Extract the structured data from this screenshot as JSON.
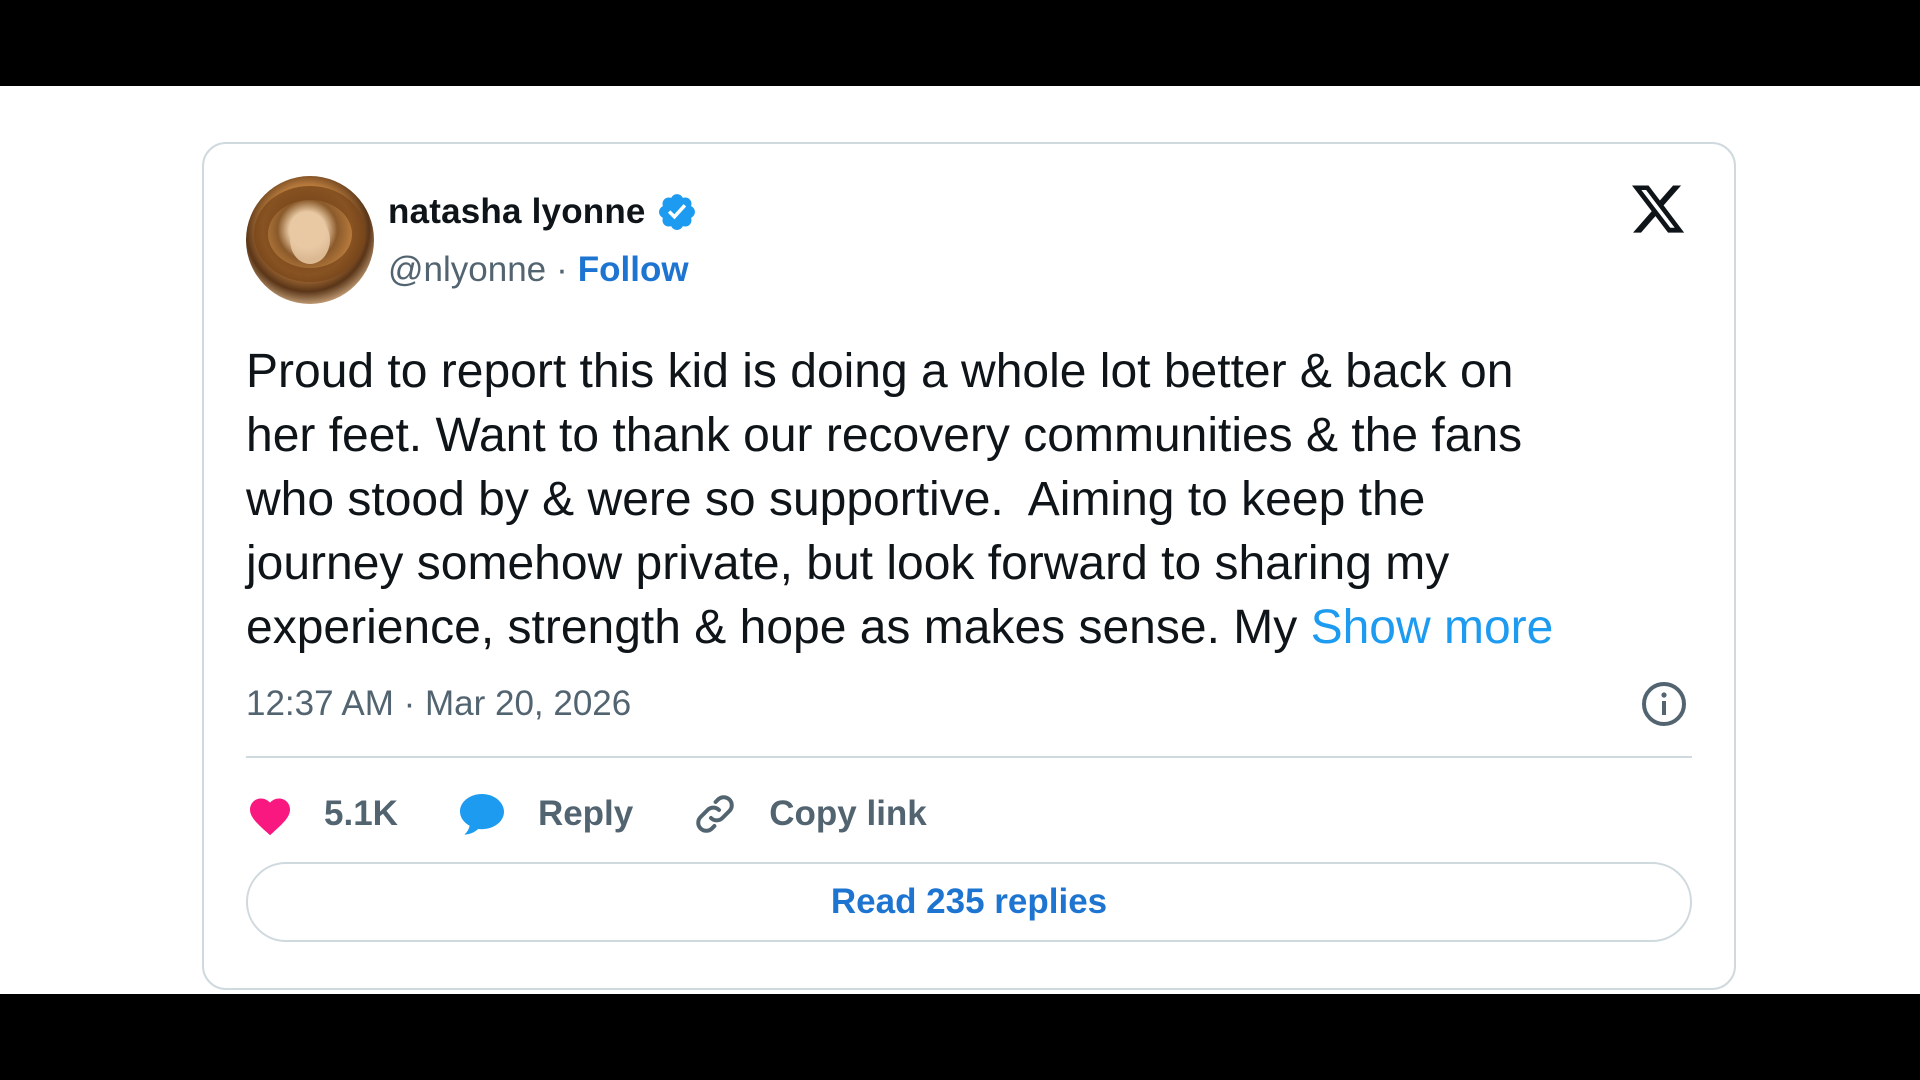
{
  "tweet": {
    "author_name": "natasha lyonne",
    "handle": "@nlyonne",
    "separator": "·",
    "follow_label": "Follow",
    "verified": true,
    "body": "Proud to report this kid is doing a whole lot better & back on\nher feet. Want to thank our recovery communities & the fans\nwho stood by & were so supportive.  Aiming to keep the\njourney somehow private, but look forward to sharing my\nexperience, strength & hope as makes sense. My ",
    "show_more_label": "Show more",
    "timestamp": "12:37 AM · Mar 20, 2026"
  },
  "actions": {
    "likes": "5.1K",
    "reply_label": "Reply",
    "copy_link_label": "Copy link"
  },
  "replies_button_label": "Read 235 replies",
  "icons": {
    "platform": "x-logo-icon",
    "verified": "verified-badge-icon",
    "info": "info-icon",
    "like": "heart-icon",
    "reply": "speech-bubble-icon",
    "copy": "link-icon"
  },
  "colors": {
    "link_blue": "#1d75d1",
    "show_more_blue": "#1d9bf0",
    "heart_pink": "#f91880",
    "text_dark": "#0f1419",
    "text_gray": "#536471",
    "border": "#cfd9de"
  }
}
